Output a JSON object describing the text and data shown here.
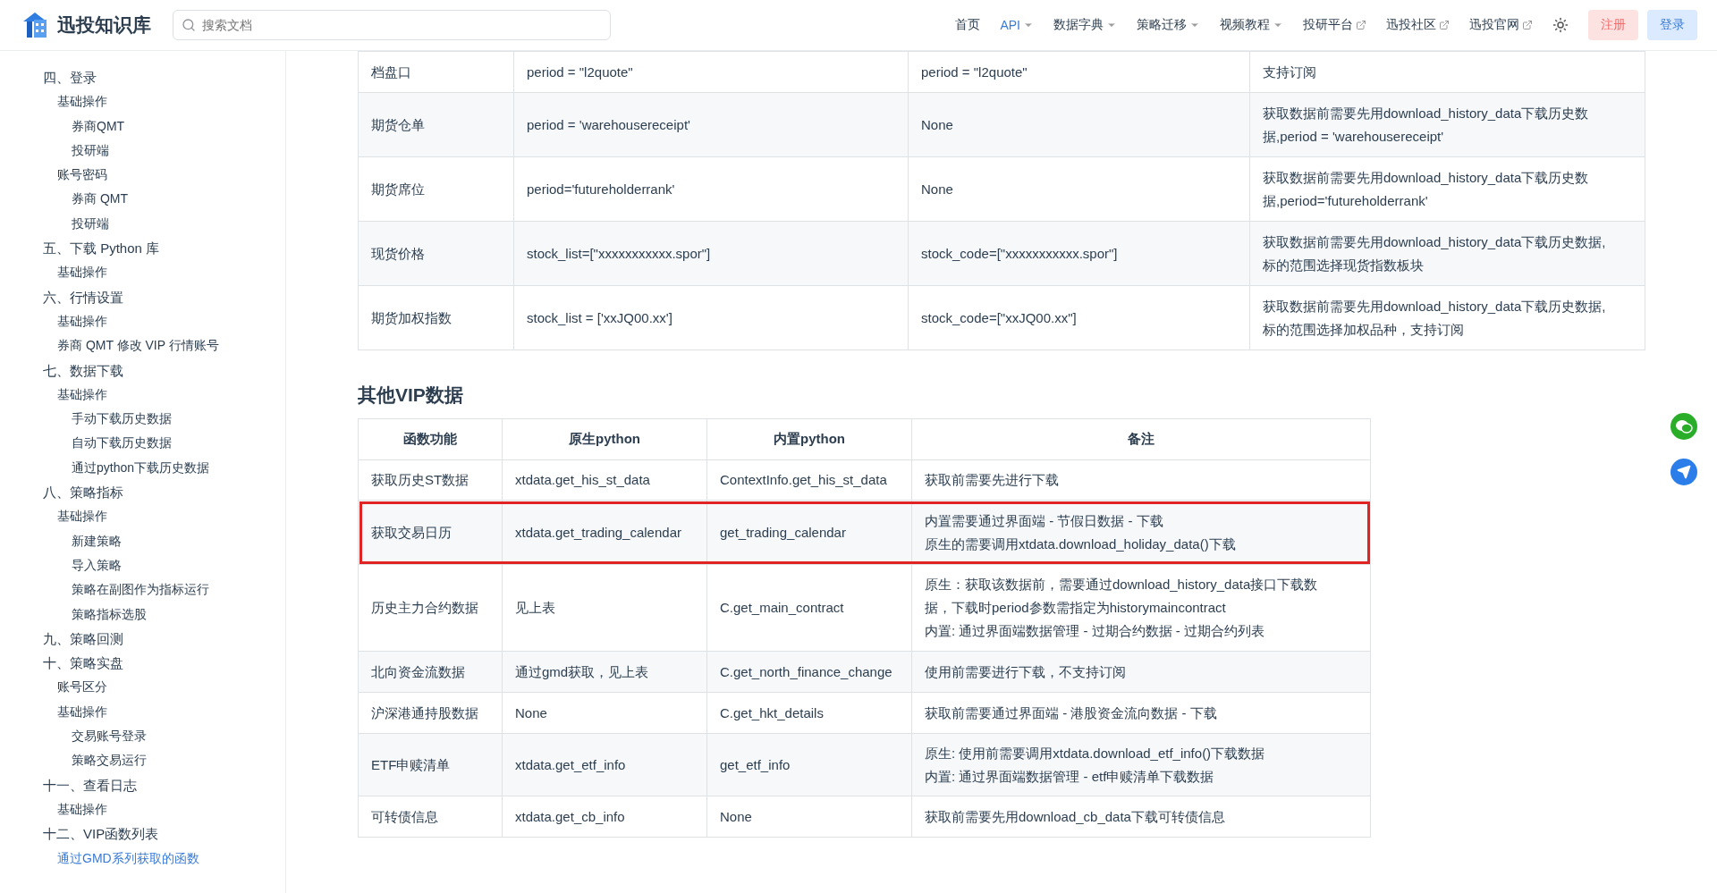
{
  "header": {
    "site_title": "迅投知识库",
    "search": {
      "placeholder": "搜索文档"
    },
    "nav": [
      {
        "label": "首页",
        "kind": "plain",
        "selected": false
      },
      {
        "label": "API",
        "kind": "dropdown",
        "selected": true
      },
      {
        "label": "数据字典",
        "kind": "dropdown",
        "selected": false
      },
      {
        "label": "策略迁移",
        "kind": "dropdown",
        "selected": false
      },
      {
        "label": "视频教程",
        "kind": "dropdown",
        "selected": false
      },
      {
        "label": "投研平台",
        "kind": "external",
        "selected": false
      },
      {
        "label": "迅投社区",
        "kind": "external",
        "selected": false
      },
      {
        "label": "迅投官网",
        "kind": "external",
        "selected": false
      }
    ],
    "buttons": [
      {
        "label": "注册",
        "kind": "register"
      },
      {
        "label": "登录",
        "kind": "login"
      }
    ]
  },
  "sidebar": {
    "items": [
      {
        "label": "四、登录",
        "selected": false,
        "children": [
          {
            "label": "基础操作",
            "selected": false,
            "children": [
              {
                "label": "券商QMT",
                "selected": false
              },
              {
                "label": "投研端",
                "selected": false
              }
            ]
          },
          {
            "label": "账号密码",
            "selected": false,
            "children": [
              {
                "label": "券商 QMT",
                "selected": false
              },
              {
                "label": "投研端",
                "selected": false
              }
            ]
          }
        ]
      },
      {
        "label": "五、下载 Python 库",
        "selected": false,
        "children": [
          {
            "label": "基础操作",
            "selected": false
          }
        ]
      },
      {
        "label": "六、行情设置",
        "selected": false,
        "children": [
          {
            "label": "基础操作",
            "selected": false
          },
          {
            "label": "券商 QMT 修改 VIP 行情账号",
            "selected": false
          }
        ]
      },
      {
        "label": "七、数据下载",
        "selected": false,
        "children": [
          {
            "label": "基础操作",
            "selected": false,
            "children": [
              {
                "label": "手动下载历史数据",
                "selected": false
              },
              {
                "label": "自动下载历史数据",
                "selected": false
              },
              {
                "label": "通过python下载历史数据",
                "selected": false
              }
            ]
          }
        ]
      },
      {
        "label": "八、策略指标",
        "selected": false,
        "children": [
          {
            "label": "基础操作",
            "selected": false,
            "children": [
              {
                "label": "新建策略",
                "selected": false
              },
              {
                "label": "导入策略",
                "selected": false
              },
              {
                "label": "策略在副图作为指标运行",
                "selected": false
              },
              {
                "label": "策略指标选股",
                "selected": false
              }
            ]
          }
        ]
      },
      {
        "label": "九、策略回测",
        "selected": false
      },
      {
        "label": "十、策略实盘",
        "selected": false,
        "children": [
          {
            "label": "账号区分",
            "selected": false
          },
          {
            "label": "基础操作",
            "selected": false,
            "children": [
              {
                "label": "交易账号登录",
                "selected": false
              },
              {
                "label": "策略交易运行",
                "selected": false
              }
            ]
          }
        ]
      },
      {
        "label": "十一、查看日志",
        "selected": false,
        "children": [
          {
            "label": "基础操作",
            "selected": false
          }
        ]
      },
      {
        "label": "十二、VIP函数列表",
        "selected": false,
        "children": [
          {
            "label": "通过GMD系列获取的函数",
            "selected": true
          }
        ]
      }
    ]
  },
  "upper_table": {
    "rows": [
      {
        "cells": [
          "档盘口",
          "period = \"l2quote\"",
          "period = \"l2quote\"",
          "支持订阅"
        ]
      },
      {
        "cells": [
          "期货仓单",
          "period = 'warehousereceipt'",
          "None",
          [
            "获取数据前需要先用download_history_data下载历史数",
            "据,period = 'warehousereceipt'"
          ]
        ]
      },
      {
        "cells": [
          "期货席位",
          "period='futureholderrank'",
          "None",
          [
            "获取数据前需要先用download_history_data下载历史数",
            "据,period='futureholderrank'"
          ]
        ]
      },
      {
        "cells": [
          "现货价格",
          "stock_list=[\"xxxxxxxxxxx.spor\"]",
          "stock_code=[\"xxxxxxxxxxx.spor\"]",
          [
            "获取数据前需要先用download_history_data下载历史数据,",
            "标的范围选择现货指数板块"
          ]
        ]
      },
      {
        "cells": [
          "期货加权指数",
          "stock_list = ['xxJQ00.xx']",
          "stock_code=[\"xxJQ00.xx\"]",
          [
            "获取数据前需要先用download_history_data下载历史数据,",
            "标的范围选择加权品种，支持订阅"
          ]
        ]
      }
    ]
  },
  "vip_section": {
    "title": "其他VIP数据",
    "columns": [
      "函数功能",
      "原生python",
      "内置python",
      "备注"
    ],
    "rows": [
      {
        "highlighted": false,
        "cells": [
          "获取历史ST数据",
          "xtdata.get_his_st_data",
          "ContextInfo.get_his_st_data",
          "获取前需要先进行下载"
        ]
      },
      {
        "highlighted": true,
        "cells": [
          "获取交易日历",
          "xtdata.get_trading_calendar",
          "get_trading_calendar",
          [
            "内置需要通过界面端 - 节假日数据 - 下载",
            "原生的需要调用xtdata.download_holiday_data()下载"
          ]
        ]
      },
      {
        "highlighted": false,
        "cells": [
          "历史主力合约数据",
          "见上表",
          "C.get_main_contract",
          [
            "原生：获取该数据前，需要通过download_history_data接口下载数",
            "据，下载时period参数需指定为historymaincontract",
            "内置: 通过界面端数据管理 - 过期合约数据 - 过期合约列表"
          ]
        ]
      },
      {
        "highlighted": false,
        "cells": [
          "北向资金流数据",
          "通过gmd获取，见上表",
          "C.get_north_finance_change",
          "使用前需要进行下载，不支持订阅"
        ]
      },
      {
        "highlighted": false,
        "cells": [
          "沪深港通持股数据",
          "None",
          "C.get_hkt_details",
          "获取前需要通过界面端 - 港股资金流向数据 - 下载"
        ]
      },
      {
        "highlighted": false,
        "cells": [
          "ETF申赎清单",
          "xtdata.get_etf_info",
          "get_etf_info",
          [
            "原生: 使用前需要调用xtdata.download_etf_info()下载数据",
            "内置: 通过界面端数据管理 - etf申赎清单下载数据"
          ]
        ]
      },
      {
        "highlighted": false,
        "cells": [
          "可转债信息",
          "xtdata.get_cb_info",
          "None",
          "获取前需要先用download_cb_data下载可转债信息"
        ]
      }
    ]
  }
}
